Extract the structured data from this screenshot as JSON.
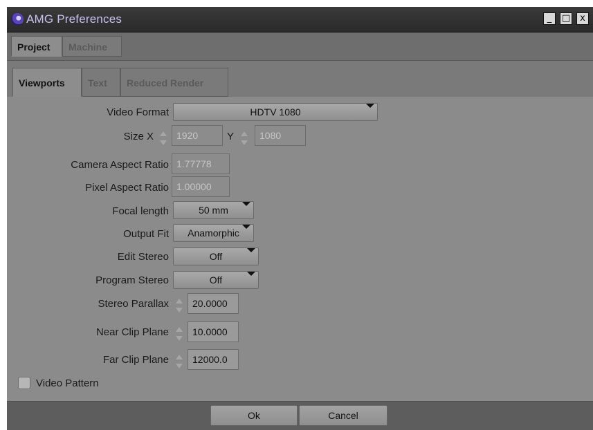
{
  "window": {
    "title": "AMG Preferences",
    "minimize": "_",
    "maximize": "□",
    "close": "x"
  },
  "tabs_top": [
    {
      "label": "Project",
      "active": true
    },
    {
      "label": "Machine",
      "active": false
    }
  ],
  "tabs_inner": [
    {
      "label": "Viewports",
      "active": true
    },
    {
      "label": "Text",
      "active": false
    },
    {
      "label": "Reduced Render",
      "active": false
    }
  ],
  "form": {
    "video_format": {
      "label": "Video Format",
      "value": "HDTV 1080"
    },
    "size": {
      "label": "Size X",
      "x_value": "1920",
      "y_label": "Y",
      "y_value": "1080"
    },
    "camera_aspect": {
      "label": "Camera Aspect Ratio",
      "value": "1.77778"
    },
    "pixel_aspect": {
      "label": "Pixel Aspect Ratio",
      "value": "1.00000"
    },
    "focal_length": {
      "label": "Focal length",
      "value": "50 mm"
    },
    "output_fit": {
      "label": "Output Fit",
      "value": "Anamorphic"
    },
    "edit_stereo": {
      "label": "Edit Stereo",
      "value": "Off"
    },
    "program_stereo": {
      "label": "Program Stereo",
      "value": "Off"
    },
    "stereo_parallax": {
      "label": "Stereo Parallax",
      "value": "20.0000"
    },
    "near_clip": {
      "label": "Near Clip Plane",
      "value": "10.0000"
    },
    "far_clip": {
      "label": "Far Clip Plane",
      "value": "12000.0"
    },
    "video_pattern": {
      "label": "Video Pattern",
      "checked": false
    }
  },
  "footer": {
    "ok": "Ok",
    "cancel": "Cancel"
  },
  "colors": {
    "title_text": "#c8c0ee",
    "panel_bg": "#8b8b8b",
    "readonly_text": "#c6c6c6"
  }
}
